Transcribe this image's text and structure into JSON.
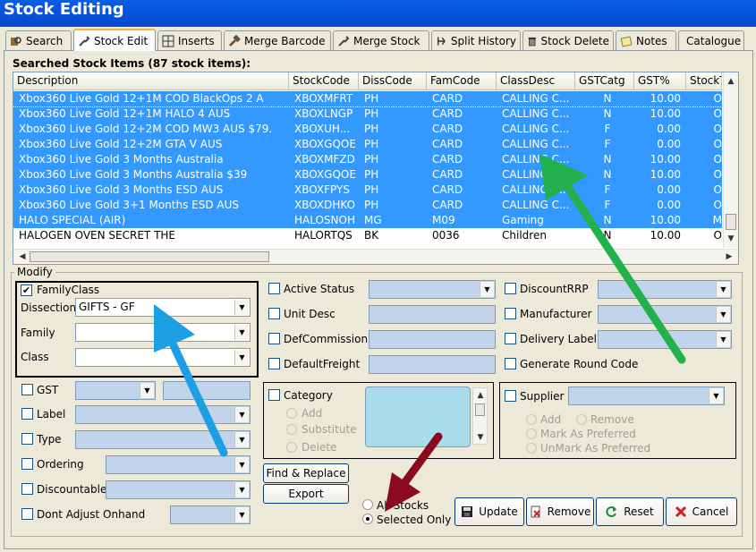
{
  "window": {
    "title": "Stock Editing"
  },
  "tabs": [
    {
      "label": "Search",
      "icon": "search-icon"
    },
    {
      "label": "Stock Edit",
      "icon": "tools-icon"
    },
    {
      "label": "Inserts",
      "icon": "grid-icon"
    },
    {
      "label": "Merge Barcode",
      "icon": "hammer-icon"
    },
    {
      "label": "Merge Stock",
      "icon": "tools-icon"
    },
    {
      "label": "Split History",
      "icon": "split-icon"
    },
    {
      "label": "Stock Delete",
      "icon": "trash-icon"
    },
    {
      "label": "Notes",
      "icon": "note-icon"
    },
    {
      "label": "Catalogue",
      "icon": ""
    }
  ],
  "grid": {
    "title": "Searched Stock Items (87 stock items):",
    "columns": [
      "Description",
      "StockCode",
      "DissCode",
      "FamCode",
      "ClassDesc",
      "GSTCatg",
      "GST%",
      "StockT"
    ],
    "rows": [
      [
        "Xbox360 Live Gold 12+1M COD BlackOps 2 A",
        "XBOXMFRT",
        "PH",
        "CARD",
        "CALLING C...",
        "N",
        "10.00",
        "O"
      ],
      [
        "Xbox360 Live Gold 12+1M HALO 4 AUS",
        "XBOXLNGP",
        "PH",
        "CARD",
        "CALLING C...",
        "N",
        "10.00",
        "O"
      ],
      [
        "Xbox360 Live Gold 12+2M COD MW3 AUS $79.",
        "XBOXUH...",
        "PH",
        "CARD",
        "CALLING C...",
        "F",
        "0.00",
        "O"
      ],
      [
        "Xbox360 Live Gold 12+2M GTA V AUS",
        "XBOXGQOE",
        "PH",
        "CARD",
        "CALLING C...",
        "F",
        "0.00",
        "O"
      ],
      [
        "Xbox360 Live Gold 3 Months Australia",
        "XBOXMFZD",
        "PH",
        "CARD",
        "CALLING C...",
        "N",
        "10.00",
        "O"
      ],
      [
        "Xbox360 Live Gold 3 Months Australia $39",
        "XBOXGQOE",
        "PH",
        "CARD",
        "CALLING C...",
        "N",
        "10.00",
        "O"
      ],
      [
        "Xbox360 Live Gold 3 Months ESD AUS",
        "XBOXFPYS",
        "PH",
        "CARD",
        "CALLING C...",
        "F",
        "0.00",
        "O"
      ],
      [
        "Xbox360 Live Gold 3+1 Months ESD AUS",
        "XBOXDHKO",
        "PH",
        "CARD",
        "CALLING C...",
        "F",
        "0.00",
        "O"
      ],
      [
        "HALO SPECIAL (AIR)",
        "HALOSNOH",
        "MG",
        "M09",
        "Gaming",
        "N",
        "10.00",
        "M"
      ],
      [
        "HALOGEN OVEN SECRET  THE",
        "HALORTQS",
        "BK",
        "0036",
        "Children",
        "N",
        "10.00",
        "O"
      ]
    ]
  },
  "modify": {
    "title": "Modify",
    "family_class": {
      "label": "FamilyClass",
      "dissection_label": "Dissection",
      "dissection_value": "GIFTS - GF",
      "family_label": "Family",
      "class_label": "Class"
    },
    "left_checks": [
      "GST",
      "Label",
      "Type",
      "Ordering",
      "Discountable",
      "Dont Adjust Onhand"
    ],
    "middle_checks": [
      "Active Status",
      "Unit Desc",
      "DefCommission",
      "DefaultFreight"
    ],
    "right_checks": [
      "DiscountRRP",
      "Manufacturer",
      "Delivery Label",
      "Generate Round Code"
    ],
    "category": {
      "label": "Category",
      "options": [
        "Add",
        "Substitute",
        "Delete"
      ]
    },
    "supplier": {
      "label": "Supplier",
      "options": [
        "Add",
        "Remove",
        "Mark As Preferred",
        "UnMark As Preferred"
      ]
    },
    "find_replace_label": "Find & Replace",
    "export_label": "Export",
    "scope": {
      "all_label": "All Stocks",
      "selected_label": "Selected Only"
    },
    "buttons": {
      "update": "Update",
      "remove": "Remove",
      "reset": "Reset",
      "cancel": "Cancel"
    }
  },
  "colors": {
    "selection": "#3399ff",
    "title_bar": "#0349cf",
    "arrow_green": "#22b14c",
    "arrow_blue": "#1ca0e3",
    "arrow_red": "#8b0a1f"
  }
}
